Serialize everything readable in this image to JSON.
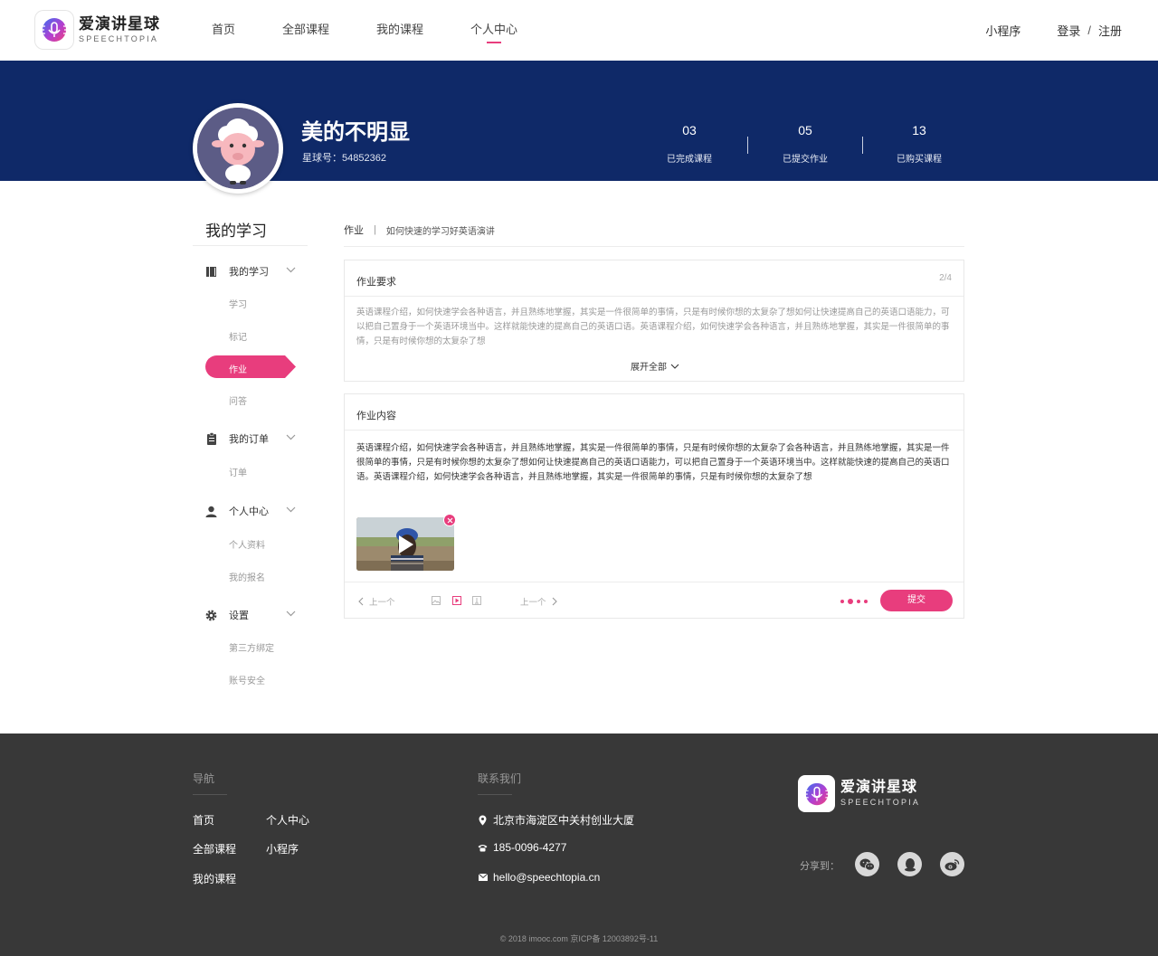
{
  "brand": {
    "name_cn": "爱演讲星球",
    "name_en": "SPEECHTOPIA"
  },
  "nav": {
    "items": [
      {
        "label": "首页"
      },
      {
        "label": "全部课程"
      },
      {
        "label": "我的课程"
      },
      {
        "label": "个人中心"
      }
    ],
    "active_index": 3,
    "mini_program": "小程序",
    "login": "登录",
    "sep": "/",
    "register": "注册"
  },
  "profile": {
    "name": "美的不明显",
    "id_text": "星球号：54852362",
    "stats": [
      {
        "value": "03",
        "label": "已完成课程"
      },
      {
        "value": "05",
        "label": "已提交作业"
      },
      {
        "value": "13",
        "label": "已购买课程"
      }
    ]
  },
  "sidebar": {
    "title": "我的学习",
    "groups": [
      {
        "label": "我的学习",
        "icon": "book-icon",
        "items": [
          "学习",
          "标记",
          "作业",
          "问答"
        ]
      },
      {
        "label": "我的订单",
        "icon": "clipboard-icon",
        "items": [
          "订单"
        ]
      },
      {
        "label": "个人中心",
        "icon": "user-icon",
        "items": [
          "个人资料",
          "我的报名"
        ]
      },
      {
        "label": "设置",
        "icon": "gear-icon",
        "items": [
          "第三方绑定",
          "账号安全"
        ]
      }
    ],
    "active_item": "作业"
  },
  "breadcrumb": {
    "section": "作业",
    "sep": "|",
    "page": "如何快速的学习好英语演讲"
  },
  "requirement": {
    "title": "作业要求",
    "counter": "2/4",
    "text": "英语课程介绍，如何快速学会各种语言，并且熟练地掌握，其实是一件很简单的事情，只是有时候你想的太复杂了想如何让快速提高自己的英语口语能力，可以把自己置身于一个英语环境当中。这样就能快速的提高自己的英语口语。英语课程介绍，如何快速学会各种语言，并且熟练地掌握，其实是一件很简单的事情，只是有时候你想的太复杂了想",
    "expand": "展开全部"
  },
  "content": {
    "title": "作业内容",
    "text": "英语课程介绍，如何快速学会各种语言，并且熟练地掌握，其实是一件很简单的事情，只是有时候你想的太复杂了会各种语言，并且熟练地掌握，其实是一件很简单的事情，只是有时候你想的太复杂了想如何让快速提高自己的英语口语能力，可以把自己置身于一个英语环境当中。这样就能快速的提高自己的英语口语。英语课程介绍，如何快速学会各种语言，并且熟练地掌握，其实是一件很简单的事情，只是有时候你想的太复杂了想",
    "prev": "上一个",
    "next": "上一个",
    "submit": "提交"
  },
  "footer": {
    "nav_title": "导航",
    "nav_links": [
      "首页",
      "个人中心",
      "全部课程",
      "小程序",
      "我的课程"
    ],
    "contact_title": "联系我们",
    "address": "北京市海淀区中关村创业大厦",
    "phone": "185-0096-4277",
    "email": "hello@speechtopia.cn",
    "share_label": "分享到：",
    "copyright": "© 2018 imooc.com  京ICP备 12003892号-11"
  },
  "colors": {
    "accent": "#e83d7d",
    "banner": "#0f2968",
    "footer": "#383838"
  }
}
